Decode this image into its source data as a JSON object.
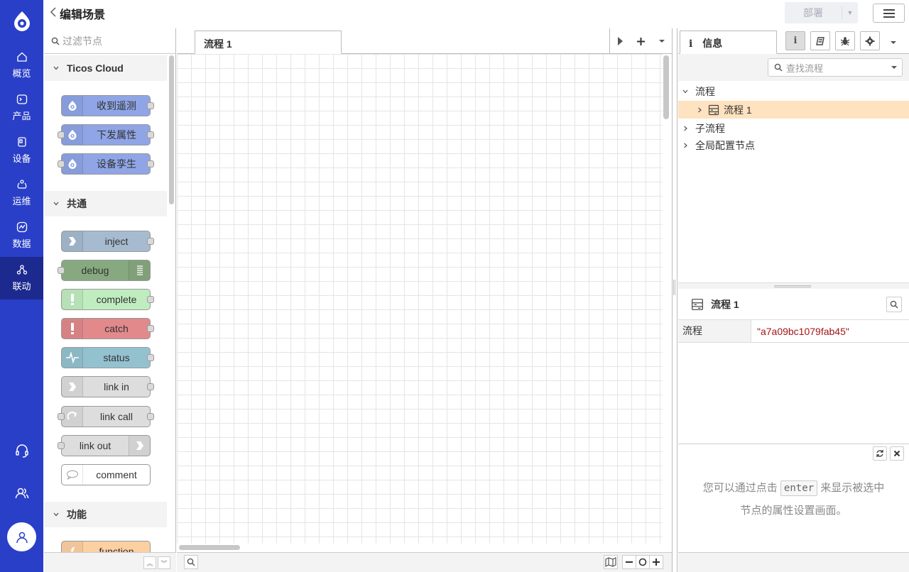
{
  "header": {
    "title": "编辑场景",
    "deploy_label": "部署"
  },
  "nav": {
    "items": [
      {
        "label": "概览"
      },
      {
        "label": "产品"
      },
      {
        "label": "设备"
      },
      {
        "label": "运维"
      },
      {
        "label": "数据"
      },
      {
        "label": "联动"
      }
    ],
    "active": "联动"
  },
  "palette": {
    "filter_placeholder": "过滤节点",
    "categories": [
      {
        "label": "Ticos Cloud",
        "nodes": [
          "收到遥测",
          "下发属性",
          "设备孪生"
        ]
      },
      {
        "label": "共通",
        "nodes": [
          "inject",
          "debug",
          "complete",
          "catch",
          "status",
          "link in",
          "link call",
          "link out",
          "comment"
        ]
      },
      {
        "label": "功能",
        "nodes": [
          "function"
        ]
      }
    ],
    "node_colors": {
      "ticos": "#8fa5e6",
      "inject": "#a6bbcf",
      "debug": "#87a980",
      "complete": "#c0edc0",
      "catch": "#e2898c",
      "status": "#94c1d0",
      "link": "#dddddd",
      "comment": "#ffffff",
      "function": "#fdd0a2"
    }
  },
  "workspace": {
    "tab_label": "流程 1"
  },
  "sidebar": {
    "tab_label": "信息",
    "search_placeholder": "查找流程",
    "tree": [
      {
        "label": "流程"
      },
      {
        "label": "流程 1"
      },
      {
        "label": "子流程"
      },
      {
        "label": "全局配置节点"
      }
    ],
    "prop_title": "流程 1",
    "prop_key": "流程",
    "prop_value": "\"a7a09bc1079fab45\"",
    "help_pre": "您可以通过点击",
    "help_key": "enter",
    "help_post": "来显示被选中",
    "help_line2": "节点的属性设置画面。"
  }
}
